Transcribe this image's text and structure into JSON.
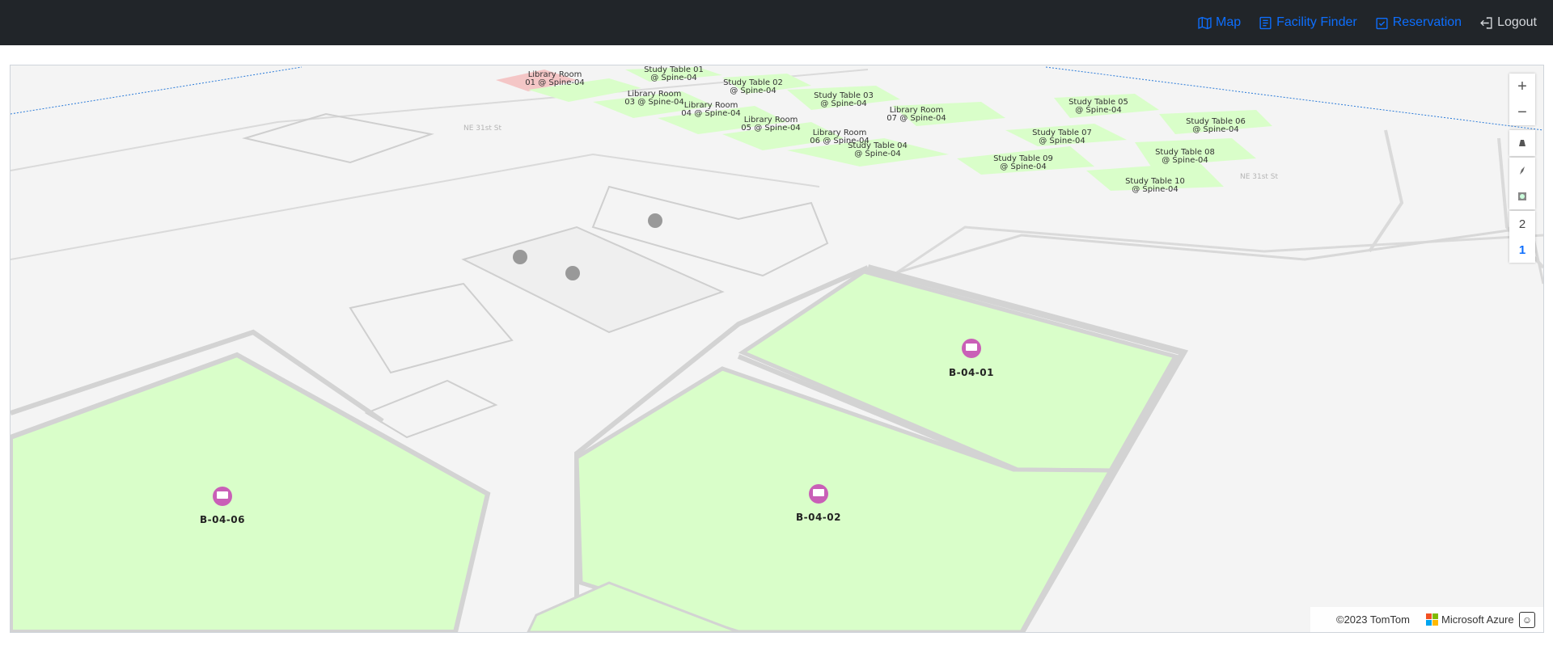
{
  "nav": {
    "map": "Map",
    "facility_finder": "Facility Finder",
    "reservation": "Reservation",
    "logout": "Logout"
  },
  "map": {
    "zoom_in": "+",
    "zoom_out": "−",
    "floors": [
      "2",
      "1"
    ],
    "active_floor": "1",
    "rooms": [
      {
        "label": "B-04-01"
      },
      {
        "label": "B-04-02"
      },
      {
        "label": "B-04-06"
      }
    ],
    "units": [
      {
        "line1": "Library Room",
        "line2": "01 @ Spine-04"
      },
      {
        "line1": "Study Table 01",
        "line2": "@ Spine-04"
      },
      {
        "line1": "Library Room",
        "line2": "03 @ Spine-04"
      },
      {
        "line1": "Study Table 02",
        "line2": "@ Spine-04"
      },
      {
        "line1": "Library Room",
        "line2": "04 @ Spine-04"
      },
      {
        "line1": "Study Table 03",
        "line2": "@ Spine-04"
      },
      {
        "line1": "Library Room",
        "line2": "05 @ Spine-04"
      },
      {
        "line1": "Library Room",
        "line2": "06 @ Spine-04"
      },
      {
        "line1": "Study Table 04",
        "line2": "@ Spine-04"
      },
      {
        "line1": "Library Room",
        "line2": "07 @ Spine-04"
      },
      {
        "line1": "Study Table 05",
        "line2": "@ Spine-04"
      },
      {
        "line1": "Study Table 07",
        "line2": "@ Spine-04"
      },
      {
        "line1": "Study Table 06",
        "line2": "@ Spine-04"
      },
      {
        "line1": "Study Table 09",
        "line2": "@ Spine-04"
      },
      {
        "line1": "Study Table 08",
        "line2": "@ Spine-04"
      },
      {
        "line1": "Study Table 10",
        "line2": "@ Spine-04"
      }
    ],
    "attribution": {
      "copyright": "©2023 TomTom",
      "provider": "Microsoft Azure"
    },
    "colors": {
      "room_fill": "#d9fec9",
      "selected_fill": "#f4c6c6",
      "wall": "#d3d3d3",
      "marker": "#c95fb7",
      "active_floor": "#0d6efd"
    }
  }
}
